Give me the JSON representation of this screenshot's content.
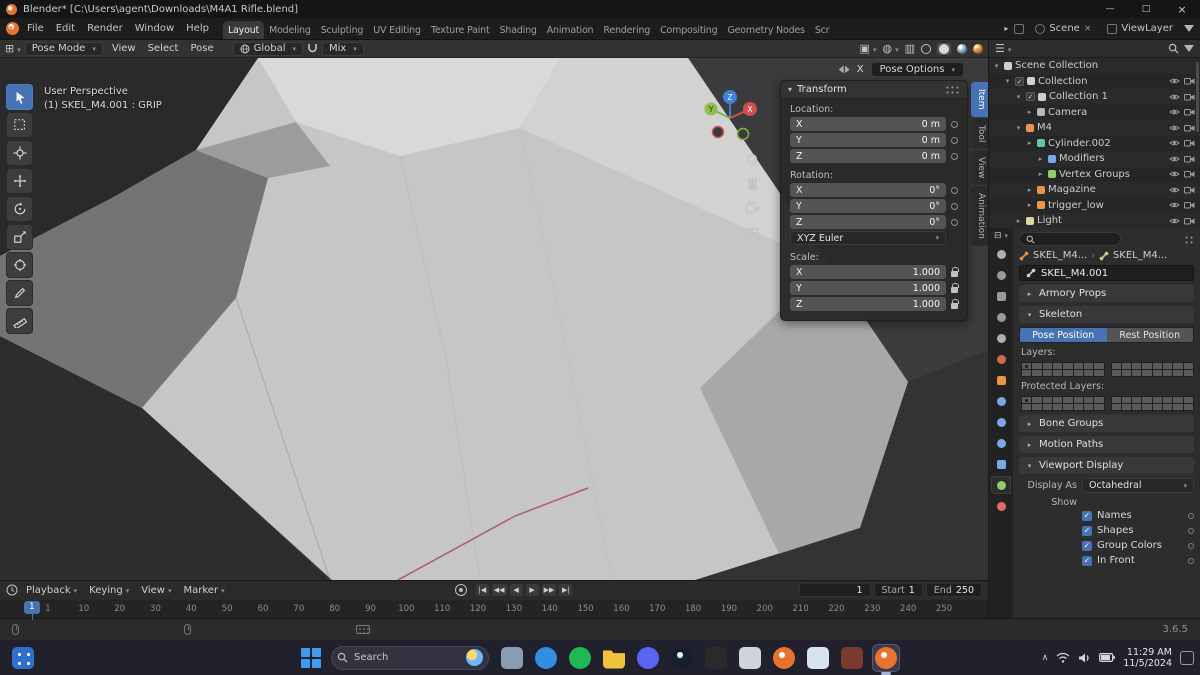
{
  "window": {
    "title": "Blender* [C:\\Users\\agent\\Downloads\\M4A1 Rifle.blend]",
    "controls": {
      "minimize": "—",
      "maximize": "□",
      "close": "×"
    }
  },
  "colors": {
    "accent": "#4772b3",
    "blender_orange": "#e8732c"
  },
  "menubar": {
    "menus": [
      {
        "label": "File"
      },
      {
        "label": "Edit"
      },
      {
        "label": "Render"
      },
      {
        "label": "Window"
      },
      {
        "label": "Help"
      }
    ],
    "tabs": [
      {
        "label": "Layout",
        "active": true
      },
      {
        "label": "Modeling"
      },
      {
        "label": "Sculpting"
      },
      {
        "label": "UV Editing"
      },
      {
        "label": "Texture Paint"
      },
      {
        "label": "Shading"
      },
      {
        "label": "Animation"
      },
      {
        "label": "Rendering"
      },
      {
        "label": "Compositing"
      },
      {
        "label": "Geometry Nodes"
      },
      {
        "label": "Scr"
      }
    ],
    "scene_label": "Scene",
    "viewlayer_label": "ViewLayer"
  },
  "toolheader": {
    "mode": "Pose Mode",
    "menus": [
      {
        "label": "View"
      },
      {
        "label": "Select"
      },
      {
        "label": "Pose"
      }
    ],
    "orientation": "Global",
    "snap_blend": "Mix"
  },
  "viewport": {
    "overlay_line1": "User Perspective",
    "overlay_line2": "(1) SKEL_M4.001 : GRIP",
    "mirror_label": "X",
    "pose_options_label": "Pose Options",
    "gizmo_axes": {
      "x": "X",
      "y": "Y",
      "z": "Z"
    },
    "tools": [
      "tweak",
      "select-box",
      "cursor",
      "move",
      "rotate",
      "scale",
      "transform",
      "annotate",
      "measure"
    ]
  },
  "sidebar_tabs": [
    {
      "label": "Item",
      "active": true
    },
    {
      "label": "Tool"
    },
    {
      "label": "View"
    },
    {
      "label": "Animation"
    }
  ],
  "transform_panel": {
    "title": "Transform",
    "location_label": "Location:",
    "location": [
      {
        "axis": "X",
        "value": "0 m"
      },
      {
        "axis": "Y",
        "value": "0 m"
      },
      {
        "axis": "Z",
        "value": "0 m"
      }
    ],
    "rotation_label": "Rotation:",
    "rotation": [
      {
        "axis": "X",
        "value": "0°"
      },
      {
        "axis": "Y",
        "value": "0°"
      },
      {
        "axis": "Z",
        "value": "0°"
      }
    ],
    "rotation_mode": "XYZ Euler",
    "scale_label": "Scale:",
    "scale": [
      {
        "axis": "X",
        "value": "1.000"
      },
      {
        "axis": "Y",
        "value": "1.000"
      },
      {
        "axis": "Z",
        "value": "1.000"
      }
    ]
  },
  "outliner": {
    "rows": [
      {
        "label": "Scene Collection",
        "indent": 0,
        "expander": "▾",
        "icon_color": "#d0d0d0",
        "checkbox": false,
        "eye": false,
        "camera": false
      },
      {
        "label": "Collection",
        "indent": 1,
        "expander": "▾",
        "icon_color": "#d0d0d0",
        "checkbox": true,
        "eye": true,
        "camera": true
      },
      {
        "label": "Collection 1",
        "indent": 2,
        "expander": "▾",
        "icon_color": "#d0d0d0",
        "checkbox": true,
        "eye": true,
        "camera": true
      },
      {
        "label": "Camera",
        "indent": 3,
        "expander": "▸",
        "icon_color": "#b8b8b8",
        "checkbox": false,
        "eye": true,
        "camera": true
      },
      {
        "label": "M4",
        "indent": 2,
        "expander": "▾",
        "icon_color": "#e8954a",
        "checkbox": false,
        "eye": true,
        "camera": true
      },
      {
        "label": "Cylinder.002",
        "indent": 3,
        "expander": "▸",
        "icon_color": "#6cc0b0",
        "checkbox": false,
        "eye": true,
        "camera": true
      },
      {
        "label": "Modifiers",
        "indent": 4,
        "expander": "▸",
        "icon_color": "#7aa8e8",
        "checkbox": false,
        "eye": true,
        "camera": true
      },
      {
        "label": "Vertex Groups",
        "indent": 4,
        "expander": "▸",
        "icon_color": "#8fce6a",
        "checkbox": false,
        "eye": true,
        "camera": true
      },
      {
        "label": "Magazine",
        "indent": 3,
        "expander": "▸",
        "icon_color": "#e8954a",
        "checkbox": false,
        "eye": true,
        "camera": true
      },
      {
        "label": "trigger_low",
        "indent": 3,
        "expander": "▸",
        "icon_color": "#e8954a",
        "checkbox": false,
        "eye": true,
        "camera": true
      },
      {
        "label": "Light",
        "indent": 2,
        "expander": "▸",
        "icon_color": "#d8d8a0",
        "checkbox": false,
        "eye": true,
        "camera": true
      }
    ]
  },
  "props_tabs": [
    {
      "name": "tool",
      "color": "#b0b0b0",
      "shape": "circle"
    },
    {
      "name": "render",
      "color": "#9a9a9a",
      "shape": "circle"
    },
    {
      "name": "output",
      "color": "#9a9a9a",
      "shape": "square"
    },
    {
      "name": "view-layer",
      "color": "#9a9a9a",
      "shape": "circle"
    },
    {
      "name": "scene",
      "color": "#b0b0b0",
      "shape": "circle"
    },
    {
      "name": "world",
      "color": "#cf6a4c",
      "shape": "circle"
    },
    {
      "name": "object",
      "color": "#e8954a",
      "shape": "square"
    },
    {
      "name": "modifiers",
      "color": "#7aa8e8",
      "shape": "circle"
    },
    {
      "name": "particles",
      "color": "#7aa8e8",
      "shape": "circle"
    },
    {
      "name": "physics",
      "color": "#7aa8e8",
      "shape": "circle"
    },
    {
      "name": "constraints",
      "color": "#7aa8e8",
      "shape": "square"
    },
    {
      "name": "data",
      "color": "#8fce6a",
      "shape": "circle",
      "active": true
    },
    {
      "name": "material",
      "color": "#e06a6a",
      "shape": "circle"
    }
  ],
  "properties": {
    "breadcrumb_item1": "SKEL_M4...",
    "breadcrumb_sep": "›",
    "breadcrumb_item2": "SKEL_M4...",
    "name_value": "SKEL_M4.001",
    "sections": {
      "armory": "Armory Props",
      "skeleton": "Skeleton",
      "bone_groups": "Bone Groups",
      "motion_paths": "Motion Paths",
      "viewport_display": "Viewport Display"
    },
    "pose_position": "Pose Position",
    "rest_position": "Rest Position",
    "layers_label": "Layers:",
    "protected_label": "Protected Layers:",
    "display_as_label": "Display As",
    "display_as_value": "Octahedral",
    "show_label": "Show",
    "show_options": [
      {
        "label": "Names",
        "checked": true
      },
      {
        "label": "Shapes",
        "checked": true
      },
      {
        "label": "Group Colors",
        "checked": true
      },
      {
        "label": "In Front",
        "checked": true
      }
    ]
  },
  "timeline": {
    "menus": [
      {
        "label": "Playback"
      },
      {
        "label": "Keying"
      },
      {
        "label": "View"
      },
      {
        "label": "Marker"
      }
    ],
    "buttons": [
      {
        "glyph": "|◀",
        "name": "jump-to-start-button"
      },
      {
        "glyph": "◀◀",
        "name": "previous-keyframe-button"
      },
      {
        "glyph": "◀",
        "name": "play-reverse-button"
      },
      {
        "glyph": "▶",
        "name": "play-button"
      },
      {
        "glyph": "▶▶",
        "name": "next-keyframe-button"
      },
      {
        "glyph": "▶|",
        "name": "jump-to-end-button"
      }
    ],
    "current_frame": "1",
    "start_label": "Start",
    "start_value": "1",
    "end_label": "End",
    "end_value": "250",
    "playhead": "1",
    "ticks": [
      "1",
      "10",
      "20",
      "30",
      "40",
      "50",
      "60",
      "70",
      "80",
      "90",
      "100",
      "110",
      "120",
      "130",
      "140",
      "150",
      "160",
      "170",
      "180",
      "190",
      "200",
      "210",
      "220",
      "230",
      "240",
      "250"
    ]
  },
  "statusbar": {
    "version": "3.6.5"
  },
  "taskbar": {
    "search_placeholder": "Search",
    "time": "11:29 AM",
    "date": "11/5/2024",
    "pinned": [
      {
        "name": "file-explorer",
        "shape": "square",
        "color": "#8a9bb4"
      },
      {
        "name": "edge-browser",
        "shape": "circle",
        "color": "#2f8ee0"
      },
      {
        "name": "spotify",
        "shape": "circle",
        "color": "#1db954"
      },
      {
        "name": "folder",
        "shape": "folder",
        "color": "#f0c23c"
      },
      {
        "name": "discord",
        "shape": "circle",
        "color": "#5865f2"
      },
      {
        "name": "steam",
        "shape": "circle",
        "color": "#14202e",
        "dot": true
      },
      {
        "name": "epic-games",
        "shape": "square",
        "color": "#2a2a2a"
      },
      {
        "name": "app-light",
        "shape": "square",
        "color": "#cfd4da"
      },
      {
        "name": "blender-alt",
        "shape": "circle",
        "color": "#e8732c",
        "dot": true
      },
      {
        "name": "notepad",
        "shape": "square",
        "color": "#d7e3f0"
      },
      {
        "name": "app-dark-red",
        "shape": "square",
        "color": "#7a3b2e"
      },
      {
        "name": "blender",
        "shape": "circle",
        "color": "#e8732c",
        "dot": true,
        "active": true
      }
    ]
  }
}
